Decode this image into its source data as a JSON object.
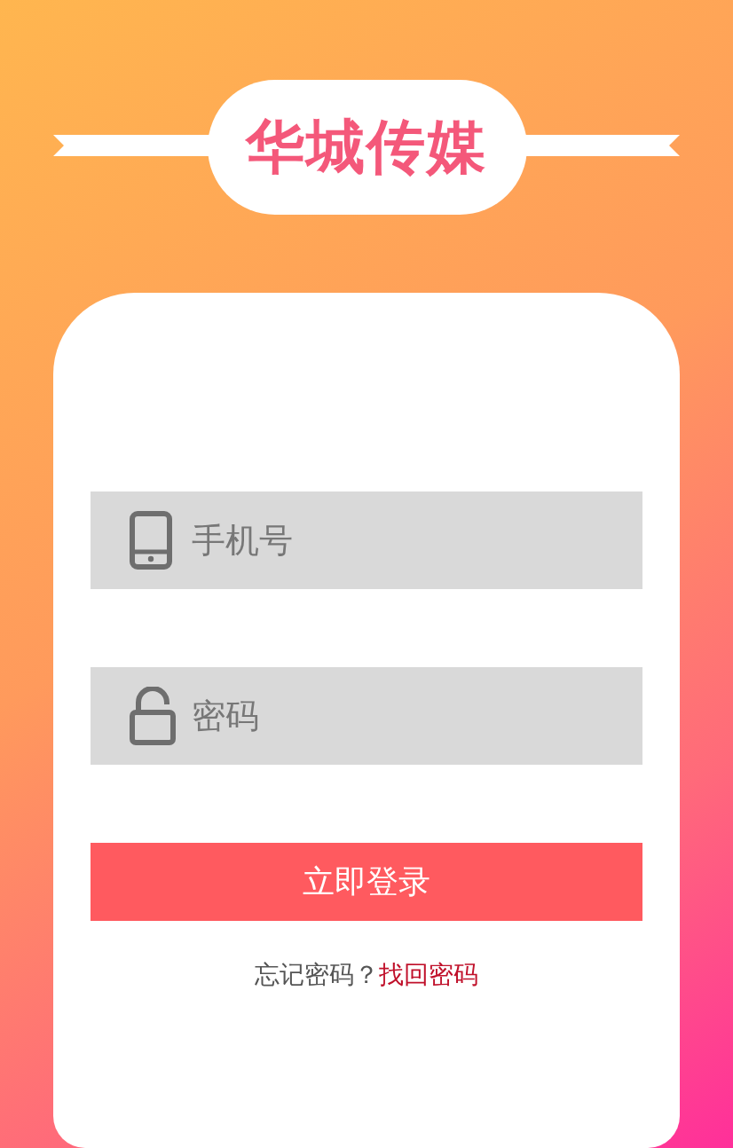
{
  "brand": {
    "title": "华城传媒"
  },
  "fields": [
    {
      "kind": "phone",
      "placeholder": "手机号"
    },
    {
      "kind": "lock",
      "placeholder": "密码"
    }
  ],
  "login_button": "立即登录",
  "forgot": {
    "text": "忘记密码？",
    "link": "找回密码"
  }
}
